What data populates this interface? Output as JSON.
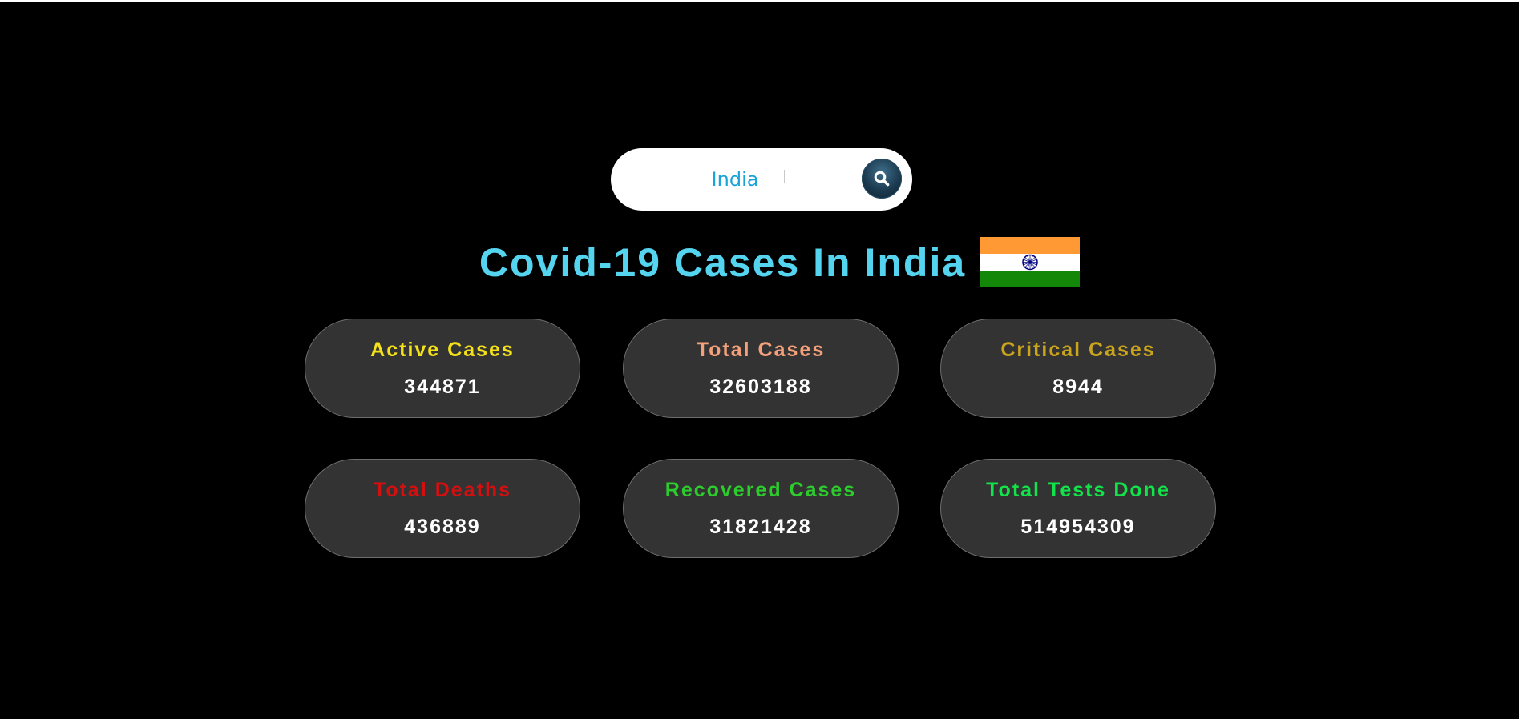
{
  "search": {
    "value": "India"
  },
  "header": {
    "title": "Covid-19 Cases In India",
    "flag_icon": "india-flag-icon"
  },
  "stats": [
    {
      "label": "Active Cases",
      "value": "344871",
      "color": "#f5e11a"
    },
    {
      "label": "Total Cases",
      "value": "32603188",
      "color": "#f4a07a"
    },
    {
      "label": "Critical Cases",
      "value": "8944",
      "color": "#c9a41c"
    },
    {
      "label": "Total Deaths",
      "value": "436889",
      "color": "#d40f0f"
    },
    {
      "label": "Recovered Cases",
      "value": "31821428",
      "color": "#2dcc2d"
    },
    {
      "label": "Total Tests Done",
      "value": "514954309",
      "color": "#12e34a"
    }
  ],
  "colors": {
    "background": "#000000",
    "title": "#55d4f0",
    "search_text": "#1aa3d9",
    "card_bg": "#333333",
    "value_text": "#ffffff"
  }
}
